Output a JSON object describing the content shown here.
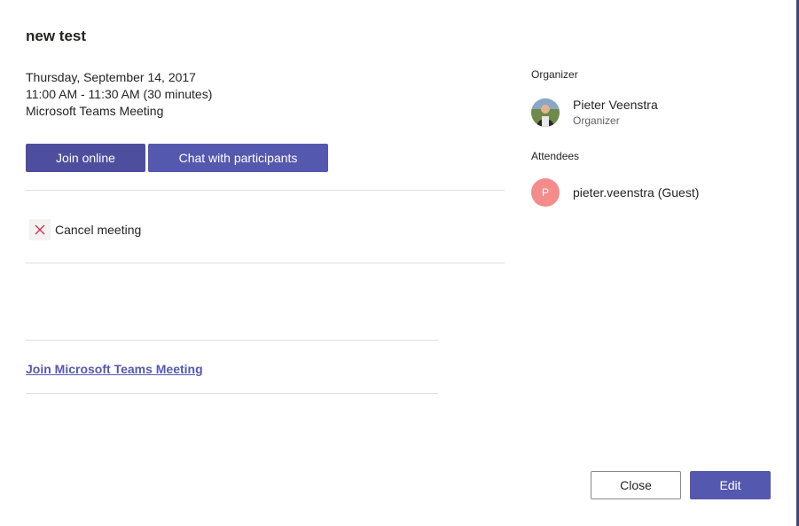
{
  "meeting": {
    "title": "new test",
    "date": "Thursday, September 14, 2017",
    "time": "11:00 AM - 11:30 AM (30 minutes)",
    "type": "Microsoft Teams Meeting"
  },
  "actions": {
    "join_label": "Join online",
    "chat_label": "Chat with participants",
    "cancel_label": "Cancel meeting",
    "cancel_icon": "close-x-icon"
  },
  "body": {
    "join_link": "Join Microsoft Teams Meeting"
  },
  "organizer": {
    "section_label": "Organizer",
    "name": "Pieter Veenstra",
    "role": "Organizer"
  },
  "attendees": {
    "section_label": "Attendees",
    "items": [
      {
        "initial": "P",
        "name": "pieter.veenstra (Guest)",
        "color": "#f48c8c"
      }
    ]
  },
  "footer": {
    "close_label": "Close",
    "edit_label": "Edit"
  },
  "colors": {
    "accent": "#5558af",
    "edge": "#464775",
    "cancel_x": "#c4314b"
  }
}
